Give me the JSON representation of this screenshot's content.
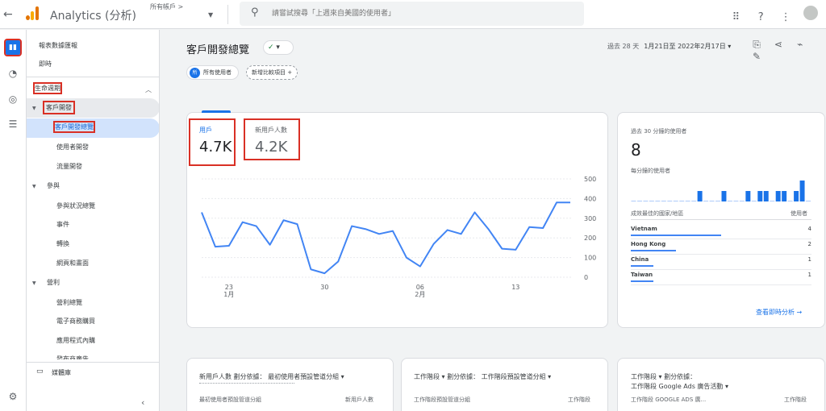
{
  "topbar": {
    "app_title": "Analytics (分析)",
    "account_label": "所有帳戶 >",
    "search_placeholder": "請嘗試搜尋「上週來自美國的使用者」",
    "brand_colors": {
      "logo_dark": "#e37400",
      "logo_light": "#f9ab00"
    }
  },
  "sidebar": {
    "reports_snapshot": "報表數據匯報",
    "realtime": "即時",
    "lifecycle": "生命週期",
    "acquisition": {
      "label": "客戶開發",
      "items": [
        "客戶開發總覽",
        "使用者開發",
        "流量開發"
      ]
    },
    "engagement": {
      "label": "參與",
      "items": [
        "參與狀況總覽",
        "事件",
        "轉換",
        "網頁和畫面"
      ]
    },
    "monetization": {
      "label": "營利",
      "items": [
        "營利總覽",
        "電子商務購買",
        "應用程式內購",
        "發布商廣告"
      ]
    },
    "library": "媒體庫"
  },
  "header": {
    "page_title": "客戶開發總覽",
    "status_check": "✓",
    "date_prefix": "過去 28 天",
    "date_range": "1月21日至 2022年2月17日"
  },
  "chips": {
    "all_users_badge": "所",
    "all_users": "所有使用者",
    "add_comparison": "新增比較項目"
  },
  "main_chart": {
    "metrics": [
      {
        "label": "用戶",
        "value": "4.7K"
      },
      {
        "label": "新用戶人數",
        "value": "4.2K"
      }
    ],
    "chart_data": {
      "type": "line",
      "x": [
        "1/21",
        "1/22",
        "1/23",
        "1/24",
        "1/25",
        "1/26",
        "1/27",
        "1/28",
        "1/29",
        "1/30",
        "1/31",
        "2/1",
        "2/2",
        "2/3",
        "2/4",
        "2/5",
        "2/6",
        "2/7",
        "2/8",
        "2/9",
        "2/10",
        "2/11",
        "2/12",
        "2/13",
        "2/14",
        "2/15",
        "2/16",
        "2/17"
      ],
      "series": [
        {
          "values": [
            330,
            155,
            160,
            280,
            260,
            165,
            290,
            270,
            40,
            20,
            80,
            260,
            245,
            220,
            235,
            100,
            55,
            170,
            240,
            220,
            330,
            245,
            145,
            140,
            255,
            250,
            380,
            380
          ]
        }
      ],
      "ylim": [
        0,
        500
      ],
      "yticks": [
        "500",
        "400",
        "300",
        "200",
        "100",
        "0"
      ],
      "xticks": [
        {
          "day": "23",
          "month": "1月"
        },
        {
          "day": "30",
          "month": ""
        },
        {
          "day": "06",
          "month": "2月"
        },
        {
          "day": "13",
          "month": ""
        }
      ],
      "line_color": "#4285f4",
      "grid": true
    }
  },
  "realtime_card": {
    "title": "過去 30 分鐘的使用者",
    "value": "8",
    "per_minute_label": "每分鐘的使用者",
    "minute_bars": [
      0,
      0,
      0,
      0,
      0,
      0,
      0,
      0,
      0,
      0,
      0,
      1,
      0,
      0,
      0,
      1,
      0,
      0,
      0,
      1,
      0,
      1,
      1,
      0,
      1,
      1,
      0,
      1,
      2,
      0
    ],
    "table_header": "成效最佳的國家/地區",
    "table_col": "使用者",
    "countries": [
      {
        "name": "Vietnam",
        "value": "4",
        "share": 1.0
      },
      {
        "name": "Hong Kong",
        "value": "2",
        "share": 0.5
      },
      {
        "name": "China",
        "value": "1",
        "share": 0.25
      },
      {
        "name": "Taiwan",
        "value": "1",
        "share": 0.25
      }
    ],
    "view_realtime": "查看即時分析"
  },
  "bottom_cards": [
    {
      "title": "新用戶人數 劃分依據： 最初使用者預設管道分組 ▾",
      "title2": "",
      "col1": "最初使用者預設管道分組",
      "col2": "新用戶人數"
    },
    {
      "title": "工作階段 ▾ 劃分依據： 工作階段預設管道分組 ▾",
      "title2": "",
      "col1": "工作階段預設管道分組",
      "col2": "工作階段"
    },
    {
      "title": "工作階段 ▾ 劃分依據：",
      "title2": "工作階段 Google Ads 廣告活動 ▾",
      "col1": "工作階段 GOOGLE ADS 廣...",
      "col2": "工作階段"
    }
  ]
}
